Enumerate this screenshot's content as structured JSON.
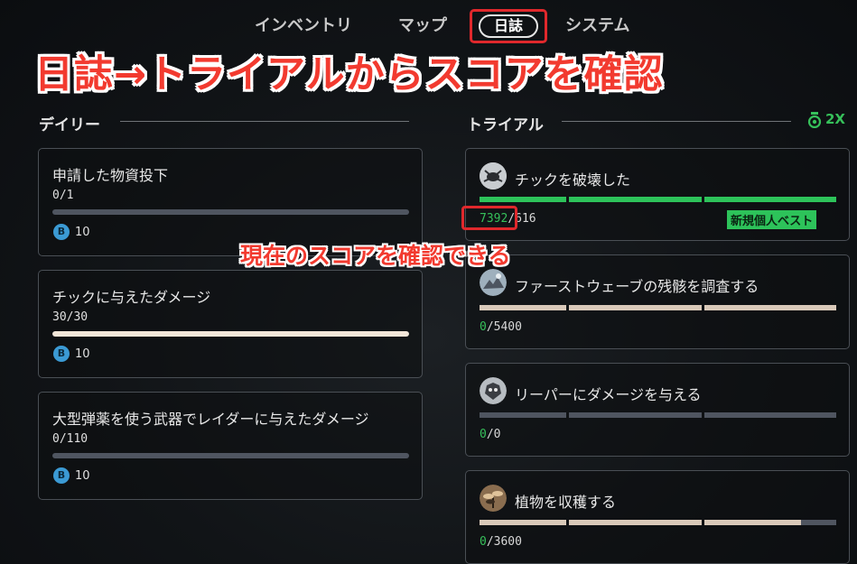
{
  "nav": {
    "items": [
      "インベントリ",
      "マップ",
      "日誌",
      "システム"
    ],
    "active": "日誌"
  },
  "annotations": {
    "main": "日誌→トライアルからスコアを確認",
    "sub": "現在のスコアを確認できる"
  },
  "daily": {
    "title": "デイリー",
    "cards": [
      {
        "title": "申請した物資投下",
        "progress": "0/1",
        "fraction": 0.0,
        "reward": "10"
      },
      {
        "title": "チックに与えたダメージ",
        "progress": "30/30",
        "fraction": 1.0,
        "reward": "10"
      },
      {
        "title": "大型弾薬を使う武器でレイダーに与えたダメージ",
        "progress": "0/110",
        "fraction": 0.0,
        "reward": "10"
      }
    ]
  },
  "trials": {
    "title": "トライアル",
    "multiplier": "2X",
    "cards": [
      {
        "title": "チックを破壊した",
        "current": "7392",
        "target": "/616",
        "segments": [
          1,
          1,
          1
        ],
        "fill_color": "#2dc35a",
        "badge": "新規個人ベスト",
        "icon": "tick-enemy-icon"
      },
      {
        "title": "ファーストウェーブの残骸を調査する",
        "current": "0",
        "target": "/5400",
        "segments": [
          1,
          1,
          1
        ],
        "fill_color": "#d9c9b9",
        "icon": "wreckage-icon"
      },
      {
        "title": "リーパーにダメージを与える",
        "current": "0",
        "target": "/0",
        "segments": [
          0,
          0,
          0
        ],
        "fill_color": "#d9c9b9",
        "icon": "reaper-enemy-icon"
      },
      {
        "title": "植物を収穫する",
        "current": "0",
        "target": "/3600",
        "segments": [
          1,
          1,
          0.73
        ],
        "fill_color": "#d9c9b9",
        "icon": "plant-icon"
      }
    ]
  },
  "colors": {
    "accent_green": "#2dc35a",
    "annotation_red": "#f23a2f",
    "reward_blue": "#3b9ad4"
  }
}
